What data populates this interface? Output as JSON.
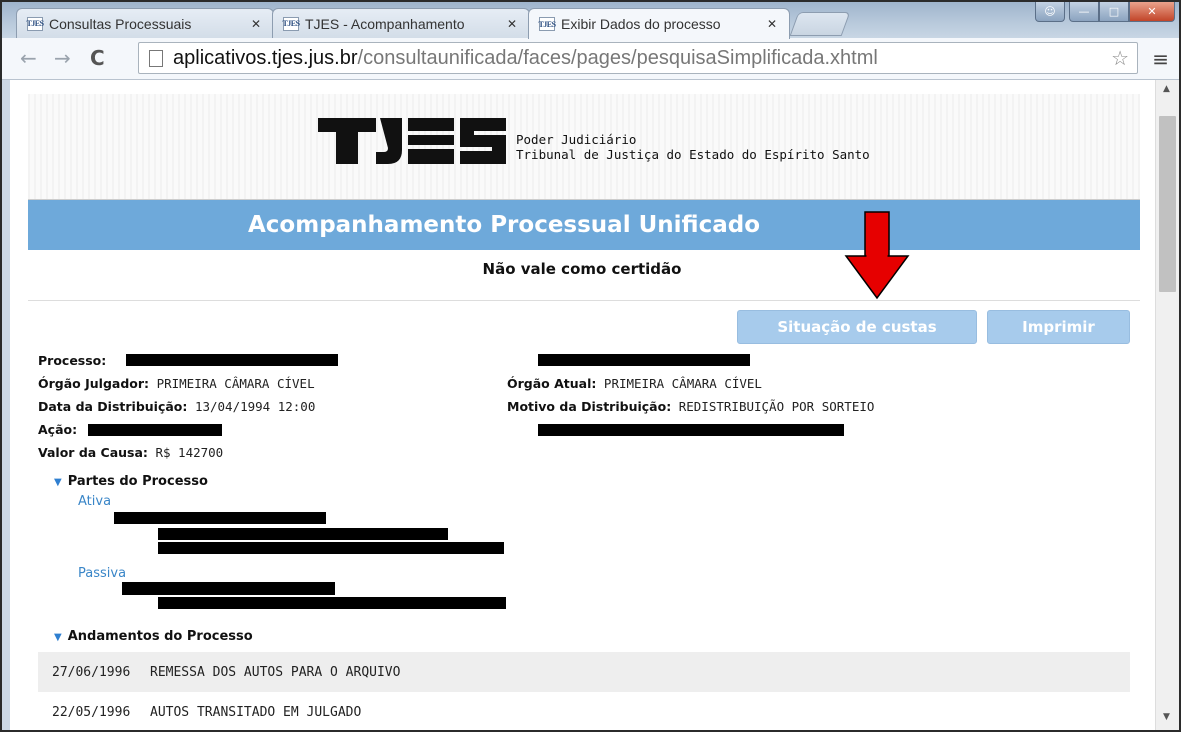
{
  "browser": {
    "tabs": [
      {
        "label": "Consultas Processuais",
        "favicon": "TJES",
        "active": false
      },
      {
        "label": "TJES - Acompanhamento",
        "favicon": "TJES",
        "active": false
      },
      {
        "label": "Exibir Dados do processo",
        "favicon": "TJES",
        "active": true
      }
    ],
    "url_host": "aplicativos.tjes.jus.br",
    "url_path": "/consultaunificada/faces/pages/pesquisaSimplificada.xhtml"
  },
  "header": {
    "logo_text": "TJES",
    "org_line1": "Poder Judiciário",
    "org_line2": "Tribunal de Justiça do Estado do Espírito Santo"
  },
  "page": {
    "title": "Acompanhamento Processual Unificado",
    "notice": "Não vale como certidão",
    "btn_custas": "Situação de custas",
    "btn_print": "Imprimir"
  },
  "process": {
    "processo_label": "Processo:",
    "orgao_julgador_label": "Órgão Julgador:",
    "orgao_julgador": "PRIMEIRA CÂMARA CÍVEL",
    "orgao_atual_label": "Órgão Atual:",
    "orgao_atual": "PRIMEIRA CÂMARA CÍVEL",
    "data_dist_label": "Data da Distribuição:",
    "data_dist": "13/04/1994 12:00",
    "motivo_label": "Motivo da Distribuição:",
    "motivo": "REDISTRIBUIÇÃO POR SORTEIO",
    "acao_label": "Ação:",
    "valor_label": "Valor da Causa:",
    "valor": "R$ 142700"
  },
  "partes": {
    "title": "Partes do Processo",
    "ativa": "Ativa",
    "passiva": "Passiva"
  },
  "andamentos": {
    "title": "Andamentos do Processo",
    "rows": [
      {
        "date": "27/06/1996",
        "desc": "REMESSA DOS AUTOS PARA O ARQUIVO"
      },
      {
        "date": "22/05/1996",
        "desc": "AUTOS TRANSITADO EM JULGADO"
      }
    ]
  },
  "colors": {
    "title_bar": "#6ea9da",
    "button": "#a7cbec",
    "arrow": "#e60000"
  }
}
